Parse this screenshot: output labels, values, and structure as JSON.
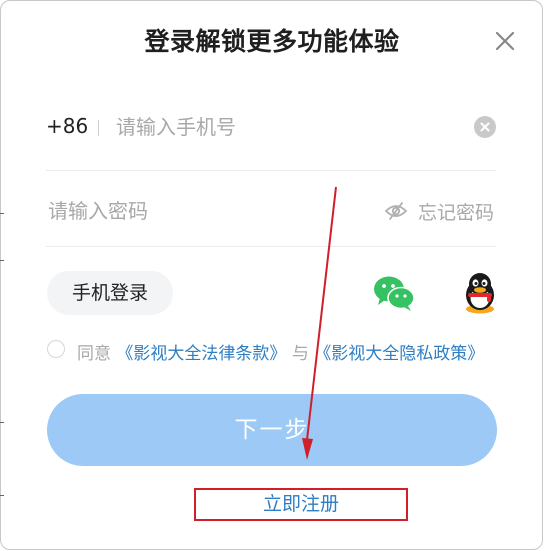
{
  "dialog": {
    "title": "登录解锁更多功能体验",
    "close_icon": "close-icon"
  },
  "phone": {
    "country_code": "+86",
    "value": "",
    "placeholder": "请输入手机号",
    "clear_icon": "clear-circle-icon"
  },
  "password": {
    "value": "",
    "placeholder": "请输入密码",
    "visibility_icon": "eye-off-icon",
    "forgot_label": "忘记密码"
  },
  "alt_login": {
    "sms_label": "手机登录",
    "wechat_icon": "wechat-icon",
    "qq_icon": "qq-icon"
  },
  "agreement": {
    "checked": false,
    "prefix": "同意",
    "terms_link": "《影视大全法律条款》",
    "joiner": "与",
    "privacy_link": "《影视大全隐私政策》"
  },
  "actions": {
    "next_label": "下一步",
    "register_label": "立即注册"
  },
  "colors": {
    "link": "#2f7ec4",
    "primary_button": "#9cc9f6",
    "annotation": "#d11f2a",
    "wechat": "#36c163"
  }
}
